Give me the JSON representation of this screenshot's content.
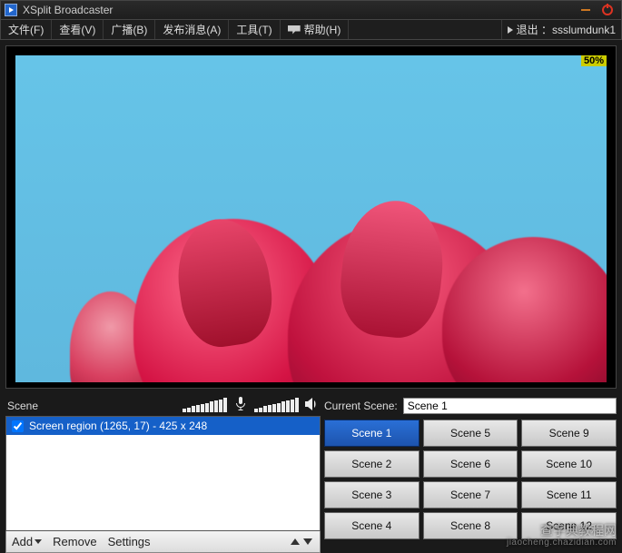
{
  "titlebar": {
    "title": "XSplit Broadcaster"
  },
  "menu": {
    "file": "文件(F)",
    "view": "查看(V)",
    "broadcast": "广播(B)",
    "publish": "发布消息(A)",
    "tools": "工具(T)",
    "help": "帮助(H)",
    "exit_prefix": "退出 ：",
    "username": "ssslumdunk1"
  },
  "preview": {
    "zoom": "50%"
  },
  "scene_panel": {
    "label": "Scene",
    "source_item": "Screen region (1265, 17) - 425 x 248",
    "footer": {
      "add": "Add",
      "remove": "Remove",
      "settings": "Settings"
    }
  },
  "current_scene": {
    "label": "Current Scene:",
    "value": "Scene 1",
    "buttons": [
      "Scene 1",
      "Scene 2",
      "Scene 3",
      "Scene 4",
      "Scene 5",
      "Scene 6",
      "Scene 7",
      "Scene 8",
      "Scene 9",
      "Scene 10",
      "Scene 11",
      "Scene 12"
    ],
    "active_index": 0
  },
  "watermark": {
    "line1": "查字典教程网",
    "line2": "jiaocheng.chazidian.com"
  }
}
